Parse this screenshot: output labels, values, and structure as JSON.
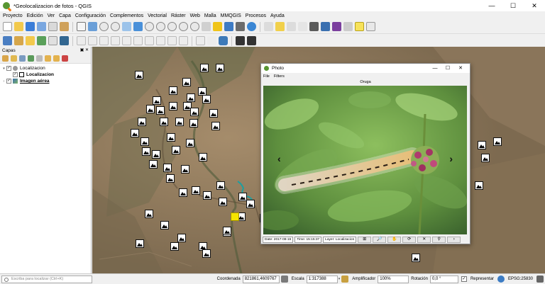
{
  "window": {
    "title": "*Geolocalizacion de fotos - QGIS",
    "buttons": [
      "—",
      "☐",
      "✕"
    ]
  },
  "menu": [
    "Proyecto",
    "Edición",
    "Ver",
    "Capa",
    "Configuración",
    "Complementos",
    "Vectorial",
    "Ráster",
    "Web",
    "Malla",
    "MMQGIS",
    "Procesos",
    "Ayuda"
  ],
  "layers_panel": {
    "title": "Capas",
    "controls": "▣ ✕",
    "items": [
      {
        "label": "Localizacion",
        "bold": false
      },
      {
        "label": "Localizacion",
        "bold": true
      },
      {
        "label": "Imagen aérea",
        "bold": true
      }
    ]
  },
  "photo_window": {
    "title": "Photo",
    "buttons": [
      "—",
      "☐",
      "✕"
    ],
    "menu": [
      "File",
      "Filters"
    ],
    "image_name": "Oruga",
    "nav_prev": "‹",
    "nav_next": "›",
    "status": {
      "date": "Date: 2017-08-15",
      "time": "Time: 15:15:37",
      "layer": "Layer: Localizacion"
    },
    "buttons_bottom": [
      "⊞",
      "🔎",
      "✋",
      "⟳",
      "✕",
      "⚲",
      "›"
    ]
  },
  "statusbar": {
    "locator_placeholder": "Escriba para localizar (Ctrl+K)",
    "coord_label": "Coordenada",
    "coord_value": "821861,4609767",
    "scale_label": "Escala",
    "scale_value": "1:317388",
    "magnifier_label": "Amplificador",
    "magnifier_value": "100%",
    "rotation_label": "Rotación",
    "rotation_value": "0,0 °",
    "render_label": "Representar",
    "render_checked": "✓",
    "crs": "EPSG:25830"
  },
  "colors": {
    "accent_yellow": "#f5e400",
    "map_base": "#8b7356",
    "qgis_green": "#589632"
  }
}
